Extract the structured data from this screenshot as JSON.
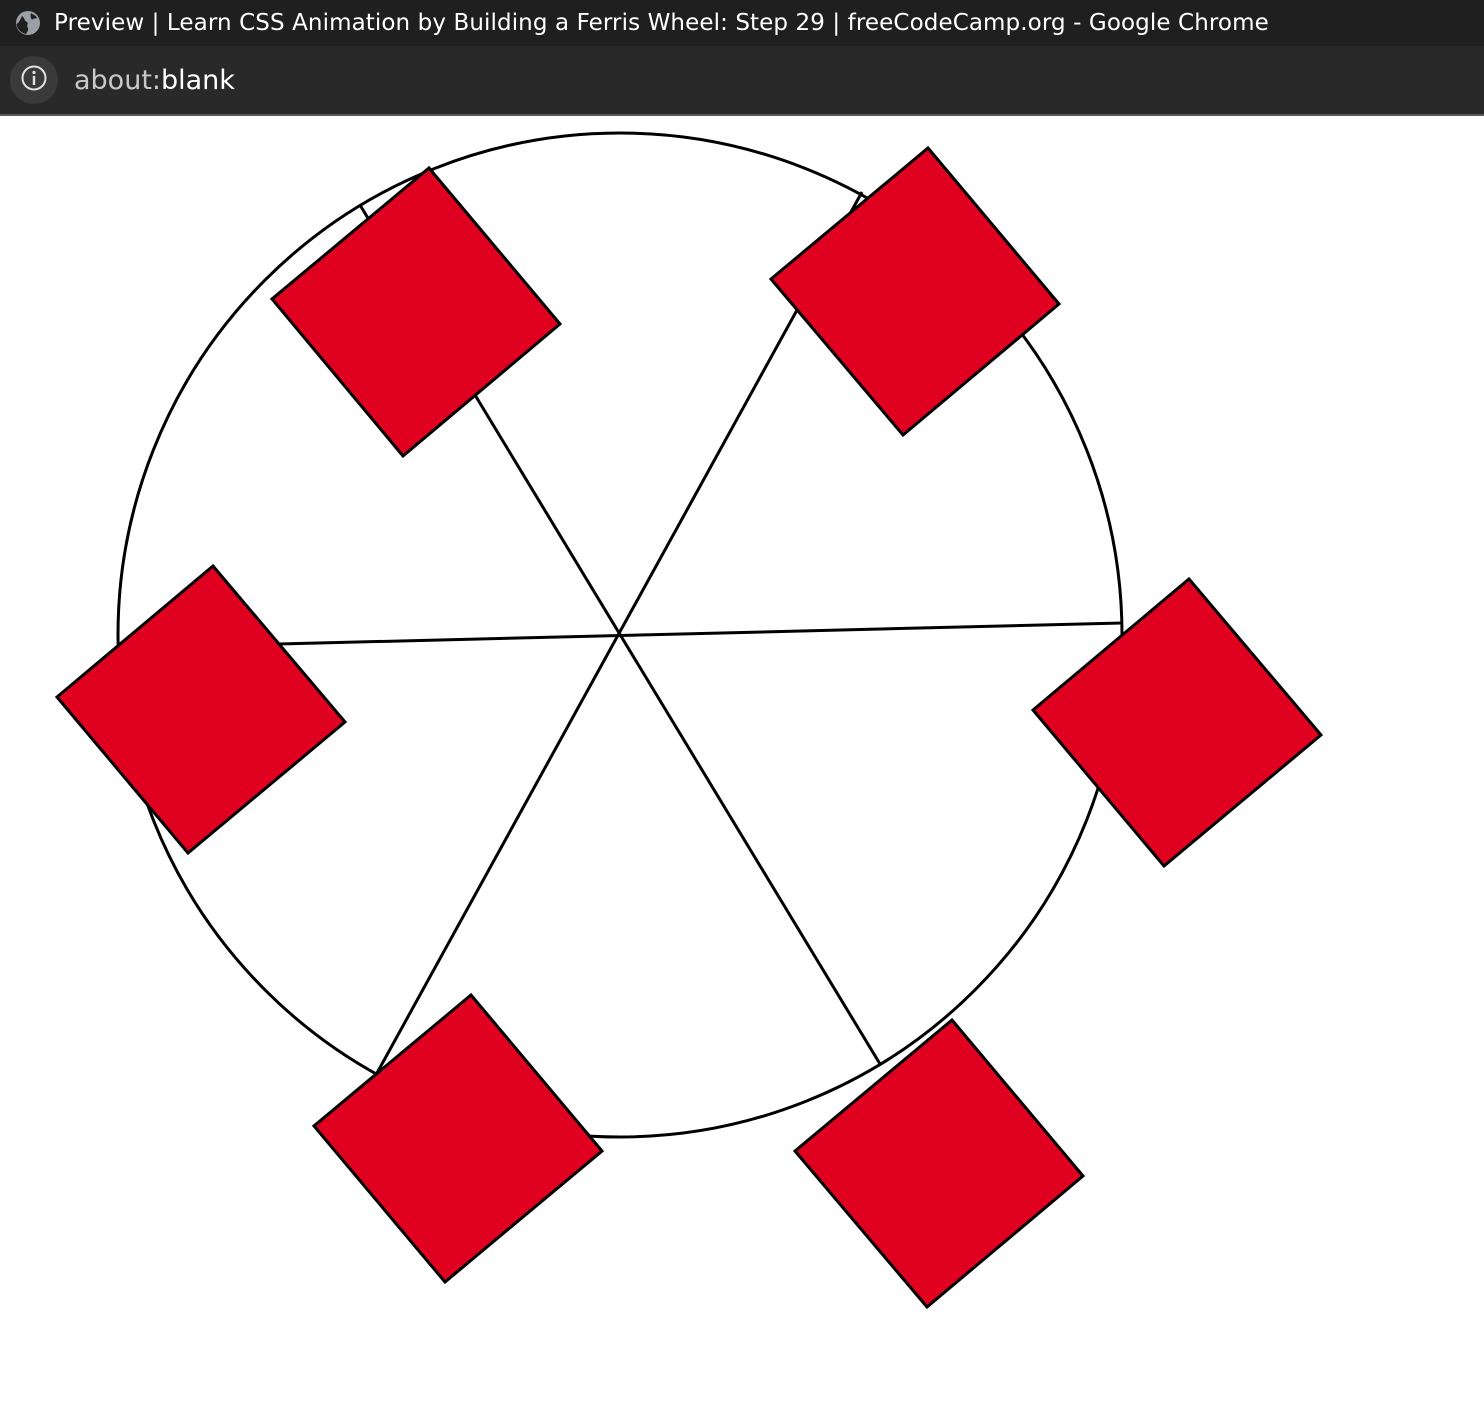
{
  "window": {
    "title": "Preview | Learn CSS Animation by Building a Ferris Wheel: Step 29 | freeCodeCamp.org - Google Chrome",
    "app_icon": "globe-icon"
  },
  "address_bar": {
    "info_icon": "info-icon",
    "url_scheme": "about:",
    "url_path": "blank"
  },
  "ferris_wheel": {
    "wheel_stroke": "#000000",
    "cabin_fill": "#e00020",
    "cabin_stroke": "#000000",
    "spoke_count": 6,
    "cabin_count": 6
  }
}
